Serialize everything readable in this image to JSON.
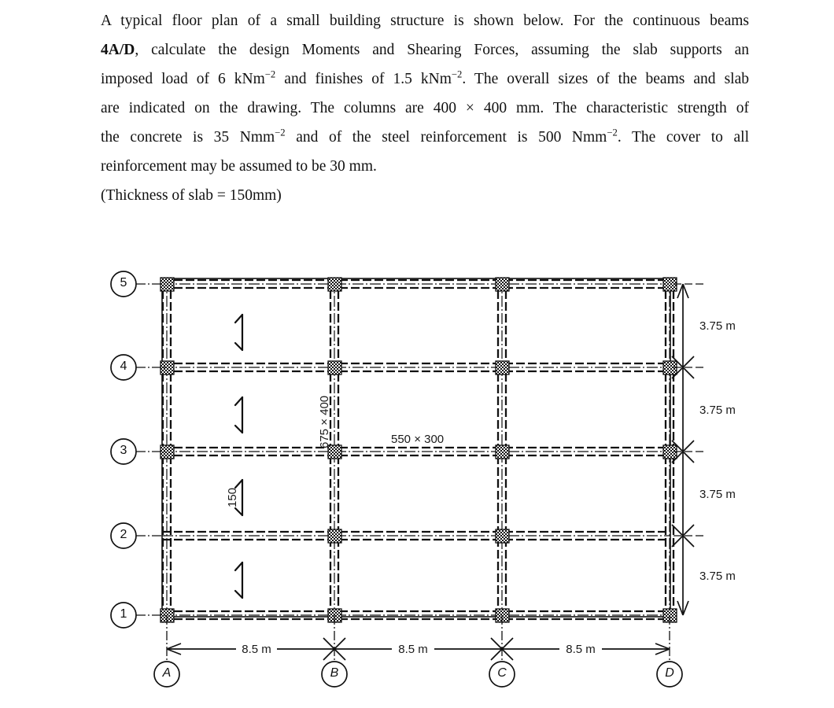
{
  "statement": {
    "line1": "A typical floor plan of a small building structure is shown below. For the continuous beams",
    "beam_ref": "4A/D",
    "line2_rest": ", calculate the design Moments and Shearing Forces, assuming the slab supports an",
    "line3_a": "imposed load of 6 kNm",
    "line3_sup1": "−2",
    "line3_b": " and finishes of 1.5 kNm",
    "line3_sup2": "−2",
    "line3_c": ". The overall sizes of the beams and slab",
    "line4": "are indicated on the drawing. The columns are 400 × 400 mm. The characteristic strength of",
    "line5_a": "the concrete is 35 Nmm",
    "line5_sup1": "−2",
    "line5_b": " and of the steel reinforcement is 500 Nmm",
    "line5_sup2": "−2",
    "line5_c": ". The cover to all",
    "line6": "reinforcement may be assumed to be 30 mm.",
    "line7": "(Thickness of slab = 150mm)"
  },
  "drawing": {
    "title": "floor-plan",
    "beam_label_vertical": "675 × 400",
    "beam_label_horizontal": "550 × 300",
    "slab_thickness_label": "150",
    "grid_rows": [
      {
        "id": "5",
        "label": "5"
      },
      {
        "id": "4",
        "label": "4"
      },
      {
        "id": "3",
        "label": "3"
      },
      {
        "id": "2",
        "label": "2"
      },
      {
        "id": "1",
        "label": "1"
      }
    ],
    "grid_cols": [
      {
        "id": "A",
        "label": "A"
      },
      {
        "id": "B",
        "label": "B"
      },
      {
        "id": "C",
        "label": "C"
      },
      {
        "id": "D",
        "label": "D"
      }
    ],
    "horizontal_dimensions": [
      {
        "label": "8.5 m"
      },
      {
        "label": "8.5 m"
      },
      {
        "label": "8.5 m"
      }
    ],
    "vertical_dimensions": [
      {
        "label": "3.75 m"
      },
      {
        "label": "3.75 m"
      },
      {
        "label": "3.75 m"
      },
      {
        "label": "3.75 m"
      }
    ],
    "colors": {
      "ink": "#111111",
      "paper": "#ffffff"
    }
  }
}
